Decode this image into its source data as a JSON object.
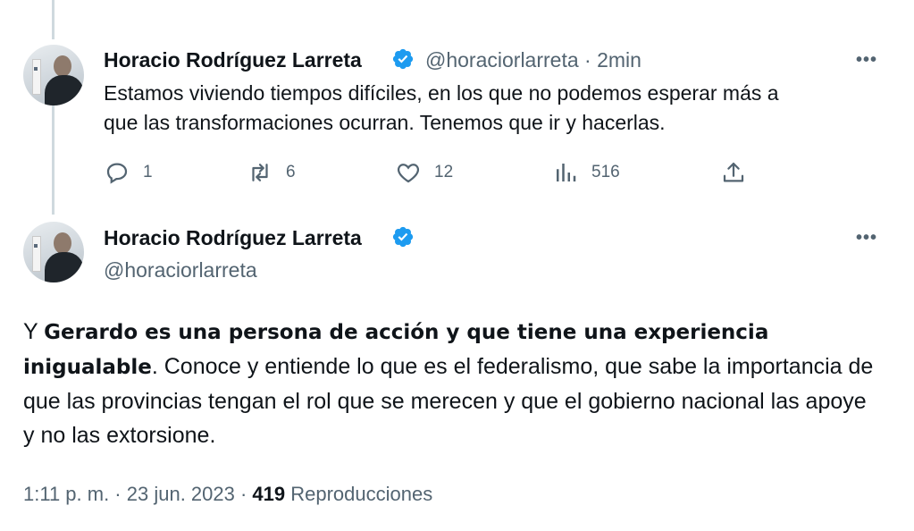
{
  "reply_tweet": {
    "author_name": "Horacio Rodríguez Larreta",
    "handle_and_time": "@horaciorlarreta · 2min",
    "more": "•••",
    "text_line1": "Estamos viviendo tiempos difíciles, en los que no podemos esperar más a",
    "text_line2": "que las transformaciones ocurran. Tenemos que ir y hacerlas.",
    "actions": {
      "replies": "1",
      "retweets": "6",
      "likes": "12",
      "views": "516"
    }
  },
  "main_tweet": {
    "author_name": "Horacio Rodríguez Larreta",
    "handle": "@horaciorlarreta",
    "more": "•••",
    "text_prefix": "Y ",
    "text_bold": "Gerardo es una persona de acción y que tiene una experiencia inigualable",
    "text_rest": ". Conoce y entiende lo que es el federalismo, que sabe la importancia de que las provincias tengan el rol que se merecen y que el gobierno nacional las apoye y no las extorsione.",
    "timestamp": "1:11 p. m. · 23 jun. 2023 · ",
    "views_count": "419",
    "views_label": " Reproducciones"
  },
  "colors": {
    "text_primary": "#0f1419",
    "text_secondary": "#536471",
    "verified_blue": "#1d9bf0",
    "thread_line": "#cfd9de"
  }
}
